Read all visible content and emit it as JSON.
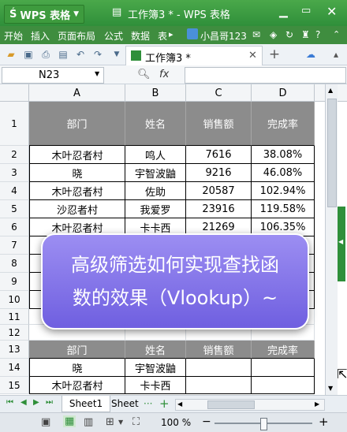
{
  "app": {
    "logo_label": "WPS 表格",
    "window_title": "工作簿3 * - WPS 表格"
  },
  "menu": {
    "items": [
      "开始",
      "插入",
      "页面布局",
      "公式",
      "数据",
      "表"
    ],
    "user": "小昌哥123"
  },
  "toolbar": {
    "doc_tab": "工作簿3 *"
  },
  "formula": {
    "name_box": "N23",
    "fx_label": "fx",
    "value": ""
  },
  "columns": [
    "A",
    "B",
    "C",
    "D"
  ],
  "rows": [
    {
      "num": "1",
      "cells": [
        "部门",
        "姓名",
        "销售额",
        "完成率"
      ],
      "type": "header"
    },
    {
      "num": "2",
      "cells": [
        "木叶忍者村",
        "鸣人",
        "7616",
        "38.08%"
      ],
      "type": "data"
    },
    {
      "num": "3",
      "cells": [
        "晓",
        "宇智波鼬",
        "9216",
        "46.08%"
      ],
      "type": "data"
    },
    {
      "num": "4",
      "cells": [
        "木叶忍者村",
        "佐助",
        "20587",
        "102.94%"
      ],
      "type": "data"
    },
    {
      "num": "5",
      "cells": [
        "沙忍者村",
        "我爱罗",
        "23916",
        "119.58%"
      ],
      "type": "data"
    },
    {
      "num": "6",
      "cells": [
        "木叶忍者村",
        "卡卡西",
        "21269",
        "106.35%"
      ],
      "type": "data"
    },
    {
      "num": "7",
      "cells": [
        "",
        "",
        "",
        ""
      ],
      "type": "data"
    },
    {
      "num": "8",
      "cells": [
        "",
        "",
        "",
        ""
      ],
      "type": "data"
    },
    {
      "num": "9",
      "cells": [
        "",
        "",
        "",
        ""
      ],
      "type": "data"
    },
    {
      "num": "10",
      "cells": [
        "",
        "",
        "",
        ""
      ],
      "type": "data"
    },
    {
      "num": "11",
      "cells": [
        "",
        "",
        "",
        ""
      ],
      "type": "blank"
    },
    {
      "num": "12",
      "cells": [
        "",
        "",
        "",
        ""
      ],
      "type": "blank"
    },
    {
      "num": "13",
      "cells": [
        "部门",
        "姓名",
        "销售额",
        "完成率"
      ],
      "type": "header2"
    },
    {
      "num": "14",
      "cells": [
        "晓",
        "宇智波鼬",
        "",
        ""
      ],
      "type": "data"
    },
    {
      "num": "15",
      "cells": [
        "木叶忍者村",
        "卡卡西",
        "",
        ""
      ],
      "type": "data"
    }
  ],
  "overlay": {
    "line1": "高级筛选如何实现查找函",
    "line2": "数的效果（Vlookup）~"
  },
  "tabs": {
    "sheet1": "Sheet1",
    "sheet2": "Sheet",
    "more": "···",
    "add": "+"
  },
  "status": {
    "zoom": "100 %",
    "zoom_minus": "−",
    "zoom_plus": "+"
  }
}
